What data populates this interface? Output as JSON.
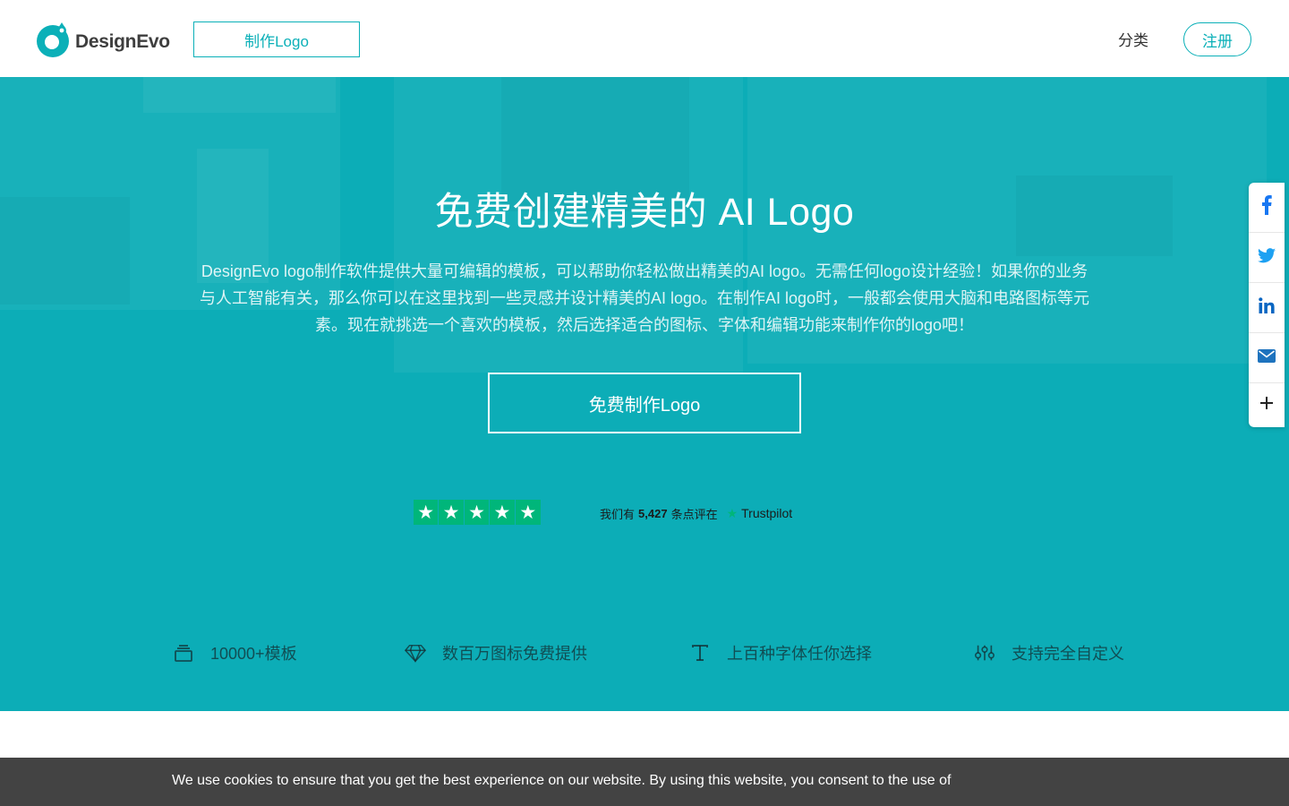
{
  "header": {
    "brand_name": "DesignEvo",
    "make_logo_label": "制作Logo",
    "nav_category_label": "分类",
    "signup_label": "注册"
  },
  "hero": {
    "title": "免费创建精美的 AI Logo",
    "description": "DesignEvo logo制作软件提供大量可编辑的模板，可以帮助你轻松做出精美的AI logo。无需任何logo设计经验！如果你的业务与人工智能有关，那么你可以在这里找到一些灵感并设计精美的AI logo。在制作AI logo时，一般都会使用大脑和电路图标等元素。现在就挑选一个喜欢的模板，然后选择适合的图标、字体和编辑功能来制作你的logo吧！",
    "cta_label": "免费制作Logo",
    "background_color": "#0cadb7"
  },
  "rating": {
    "stars": 5,
    "text_prefix": "我们有",
    "review_count": "5,427",
    "text_suffix": "条点评在",
    "provider": "Trustpilot",
    "star_color": "#00b67a"
  },
  "features": [
    {
      "icon": "layers-icon",
      "label": "10000+模板"
    },
    {
      "icon": "diamond-icon",
      "label": "数百万图标免费提供"
    },
    {
      "icon": "font-icon",
      "label": "上百种字体任你选择"
    },
    {
      "icon": "sliders-icon",
      "label": "支持完全自定义"
    }
  ],
  "social": [
    {
      "icon": "facebook-icon",
      "color": "#1877f2"
    },
    {
      "icon": "twitter-icon",
      "color": "#1da1f2"
    },
    {
      "icon": "linkedin-icon",
      "color": "#0a66c2"
    },
    {
      "icon": "email-icon",
      "color": "#1e73be"
    },
    {
      "icon": "plus-icon",
      "color": "#222222"
    }
  ],
  "cookie": {
    "text": "We use cookies to ensure that you get the best experience on our website. By using this website, you consent to the use of"
  },
  "colors": {
    "accent": "#0bb0b8",
    "cookie_bg": "#434343"
  }
}
